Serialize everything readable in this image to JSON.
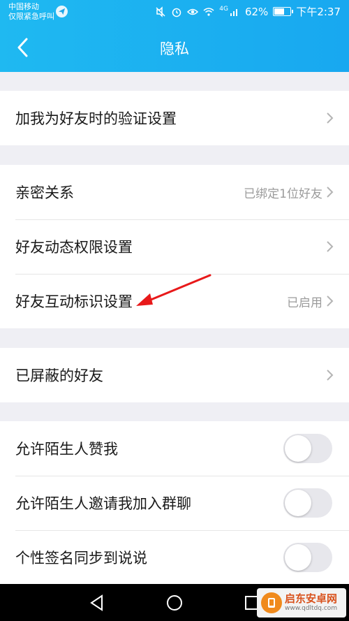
{
  "status_bar": {
    "carrier_line1": "中国移动",
    "carrier_line2": "仅限紧急呼叫",
    "battery": "62%",
    "battery_level": 0.62,
    "time": "下午2:37",
    "signal_label": "4G"
  },
  "nav": {
    "title": "隐私"
  },
  "groups": [
    {
      "rows": [
        {
          "label": "加我为好友时的验证设置"
        }
      ]
    },
    {
      "rows": [
        {
          "label": "亲密关系",
          "value": "已绑定1位好友"
        },
        {
          "label": "好友动态权限设置"
        },
        {
          "label": "好友互动标识设置",
          "value": "已启用"
        }
      ]
    },
    {
      "rows": [
        {
          "label": "已屏蔽的好友"
        }
      ]
    },
    {
      "rows": [
        {
          "label": "允许陌生人赞我",
          "toggle": false
        },
        {
          "label": "允许陌生人邀请我加入群聊",
          "toggle": false
        },
        {
          "label": "个性签名同步到说说",
          "toggle": false
        }
      ]
    }
  ],
  "watermark": {
    "name": "启东安卓网",
    "url": "www.qdltdq.com"
  },
  "colors": {
    "header": "#1fb9f1",
    "annotation_arrow": "#e8191a",
    "toggle_off": "#e7e7ec"
  }
}
